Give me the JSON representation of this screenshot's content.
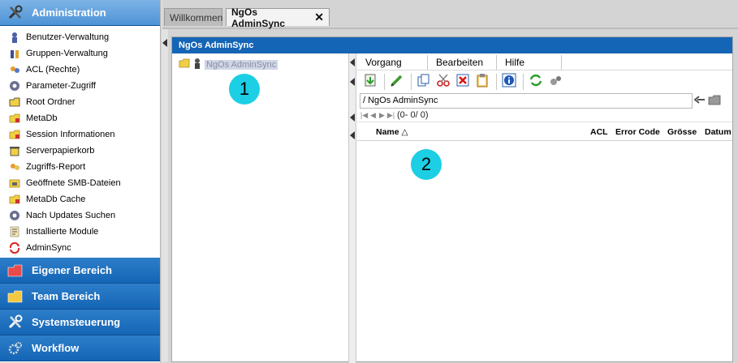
{
  "sidebar": {
    "header": "Administration",
    "items": [
      {
        "label": "Benutzer-Verwaltung",
        "icon": "user-icon"
      },
      {
        "label": "Gruppen-Verwaltung",
        "icon": "group-icon"
      },
      {
        "label": "ACL (Rechte)",
        "icon": "acl-icon"
      },
      {
        "label": "Parameter-Zugriff",
        "icon": "parameter-icon"
      },
      {
        "label": "Root Ordner",
        "icon": "folder-icon"
      },
      {
        "label": "MetaDb",
        "icon": "metadb-icon"
      },
      {
        "label": "Session Informationen",
        "icon": "session-icon"
      },
      {
        "label": "Serverpapierkorb",
        "icon": "trash-icon"
      },
      {
        "label": "Zugriffs-Report",
        "icon": "report-icon"
      },
      {
        "label": "Geöffnete SMB-Dateien",
        "icon": "smb-files-icon"
      },
      {
        "label": "MetaDb Cache",
        "icon": "cache-icon"
      },
      {
        "label": "Nach Updates Suchen",
        "icon": "update-icon"
      },
      {
        "label": "Installierte Module",
        "icon": "module-icon"
      },
      {
        "label": "AdminSync",
        "icon": "sync-icon"
      }
    ],
    "sections": [
      {
        "label": "Eigener Bereich",
        "icon": "folder-red-icon"
      },
      {
        "label": "Team Bereich",
        "icon": "folder-yellow-icon"
      },
      {
        "label": "Systemsteuerung",
        "icon": "tools-icon"
      },
      {
        "label": "Workflow",
        "icon": "gears-icon"
      }
    ]
  },
  "tabs": [
    {
      "label": "Willkommen"
    },
    {
      "label": "NgOs AdminSync",
      "close": "✕"
    }
  ],
  "panel": {
    "title": "NgOs AdminSync",
    "tree_root": "NgOs AdminSync",
    "menu": [
      "Vorgang",
      "Bearbeiten",
      "Hilfe"
    ],
    "path": "/ NgOs AdminSync",
    "pager": "(0- 0/ 0)",
    "columns": {
      "name": "Name",
      "acl": "ACL",
      "error": "Error Code",
      "size": "Grösse",
      "date": "Datum"
    },
    "sort_indicator": "△"
  },
  "badges": [
    "1",
    "2"
  ],
  "colors": {
    "accent": "#1565b6",
    "badge": "#1ccfe4"
  }
}
